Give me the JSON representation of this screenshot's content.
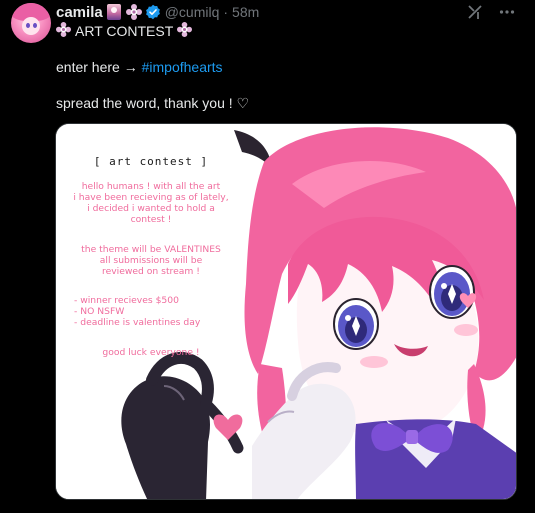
{
  "post": {
    "display_name": "camila",
    "handle": "@cumilq",
    "separator": "·",
    "time": "58m",
    "line1_text": "ART CONTEST",
    "line2_prefix": "enter here →",
    "line2_hashtag": "#impofhearts",
    "line3_text": "spread the word, thank you ! ♡"
  },
  "icons": {
    "avatar": "avatar",
    "tarot": "tarot-card-emoji",
    "flower": "flower-badge-icon",
    "verified": "verified-badge-icon",
    "grok": "grok-icon",
    "more": "more-icon"
  },
  "image": {
    "title": "[ art contest ]",
    "intro": [
      "hello humans ! with all the art",
      "i have been recieving as of lately,",
      "i decided i wanted to hold a",
      "contest !"
    ],
    "theme": [
      "the theme will be VALENTINES",
      "all submissions will be",
      "reviewed on stream !"
    ],
    "rules": [
      "- winner recieves $500",
      "- NO NSFW",
      "- deadline is valentines day"
    ],
    "closing": "good luck everyone !"
  },
  "colors": {
    "background": "#000000",
    "text": "#e7e9ea",
    "muted": "#71767b",
    "link": "#1d9bf0",
    "verified": "#1d9bf0",
    "contest_pink": "#f06c9d",
    "hair_pink": "#f2649f"
  }
}
